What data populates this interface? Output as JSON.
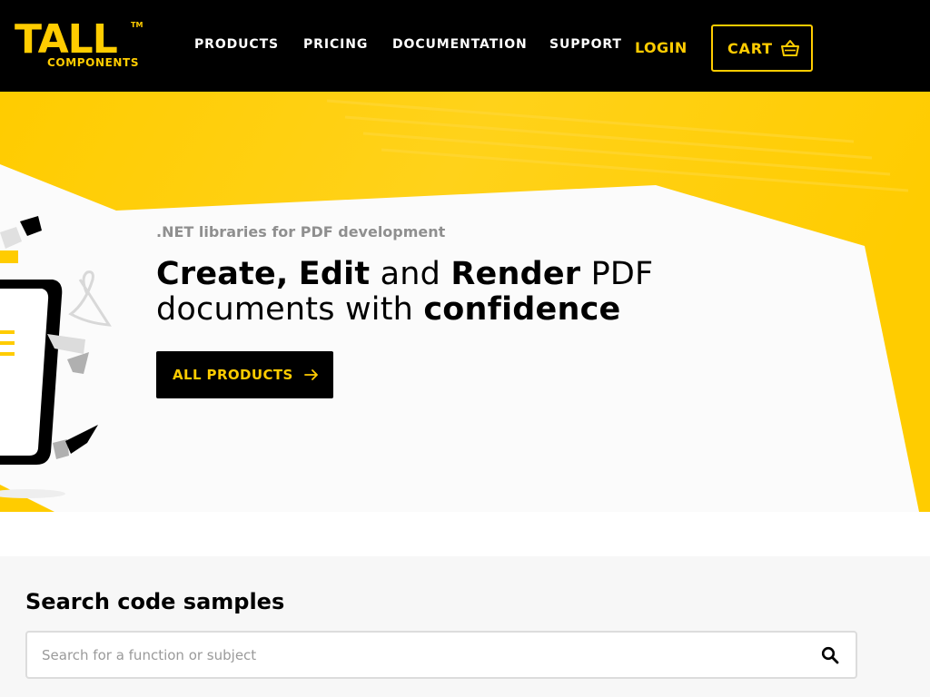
{
  "brand": {
    "logo_text": "TALL",
    "logo_subtext": "COMPONENTS",
    "logo_mark": "™"
  },
  "nav": {
    "items": [
      {
        "label": "PRODUCTS"
      },
      {
        "label": "PRICING"
      },
      {
        "label": "DOCUMENTATION"
      },
      {
        "label": "SUPPORT"
      }
    ],
    "login_label": "LOGIN",
    "cart_label": "CART",
    "cart_icon": "basket-icon"
  },
  "hero": {
    "subtitle": ".NET libraries for PDF development",
    "heading": {
      "part1": "Create,",
      "part2": "Edit",
      "part3": "and",
      "part4": "Render",
      "part5": "PDF",
      "part6": "documents with",
      "part7": "confidence"
    },
    "cta_label": "ALL PRODUCTS",
    "cta_icon": "arrow-right-icon"
  },
  "search": {
    "title": "Search code samples",
    "placeholder": "Search for a function or subject",
    "value": "",
    "button_icon": "search-icon"
  },
  "colors": {
    "brand_yellow": "#ffcc00",
    "header_bg": "#000000",
    "hero_bg": "#fbfbfb",
    "search_bg": "#f7f7f7"
  }
}
